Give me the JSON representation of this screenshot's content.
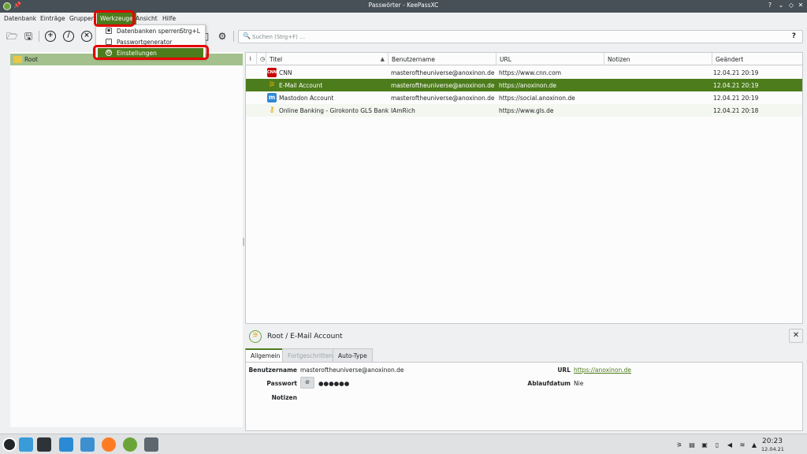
{
  "window": {
    "title": "Passwörter - KeePassXC"
  },
  "menubar": {
    "items": [
      "Datenbank",
      "Einträge",
      "Gruppen",
      "Werkzeuge",
      "Ansicht",
      "Hilfe"
    ]
  },
  "tools_menu": {
    "items": [
      {
        "label": "Datenbanken sperren",
        "shortcut": "Strg+L"
      },
      {
        "label": "Passwortgenerator",
        "shortcut": ""
      },
      {
        "label": "Einstellungen",
        "shortcut": ""
      }
    ]
  },
  "toolbar": {
    "icons": [
      "open-database-icon",
      "save-database-icon",
      "add-entry-icon",
      "edit-entry-icon",
      "delete-entry-icon",
      "password-generator-icon",
      "settings-icon"
    ]
  },
  "search": {
    "placeholder": "Suchen (Strg+F) …",
    "help": "?"
  },
  "groups": {
    "root": "Root"
  },
  "table": {
    "columns": [
      "Titel",
      "Benutzername",
      "URL",
      "Notizen",
      "Geändert"
    ],
    "rows": [
      {
        "icon": "CNN",
        "title": "CNN",
        "username": "masteroftheuniverse@anoxinon.de",
        "url": "https://www.cnn.com",
        "notes": "",
        "modified": "12.04.21 20:19"
      },
      {
        "icon": "mail",
        "title": "E-Mail Account",
        "username": "masteroftheuniverse@anoxinon.de",
        "url": "https://anoxinon.de",
        "notes": "",
        "modified": "12.04.21 20:19"
      },
      {
        "icon": "mastodon",
        "title": "Mastodon Account",
        "username": "masteroftheuniverse@anoxinon.de",
        "url": "https://social.anoxinon.de",
        "notes": "",
        "modified": "12.04.21 20:19"
      },
      {
        "icon": "key",
        "title": "Online Banking - Girokonto GLS Bank",
        "username": "IAmRich",
        "url": "https://www.gls.de",
        "notes": "",
        "modified": "12.04.21 20:18"
      }
    ]
  },
  "details": {
    "title": "Root / E-Mail Account",
    "tabs": [
      "Allgemein",
      "Fortgeschritten",
      "Auto-Type"
    ],
    "labels": {
      "username": "Benutzername",
      "password": "Passwort",
      "notes": "Notizen",
      "url": "URL",
      "expiry": "Ablaufdatum"
    },
    "values": {
      "username": "masteroftheuniverse@anoxinon.de",
      "password": "●●●●●●",
      "url": "https://anoxinon.de",
      "expiry": "Nie"
    }
  },
  "taskbar": {
    "time": "20:23",
    "date": "12.04.21"
  },
  "colors": {
    "accent": "#4d7c1c",
    "highlight_ring": "#e50000",
    "titlebar": "#475057"
  }
}
